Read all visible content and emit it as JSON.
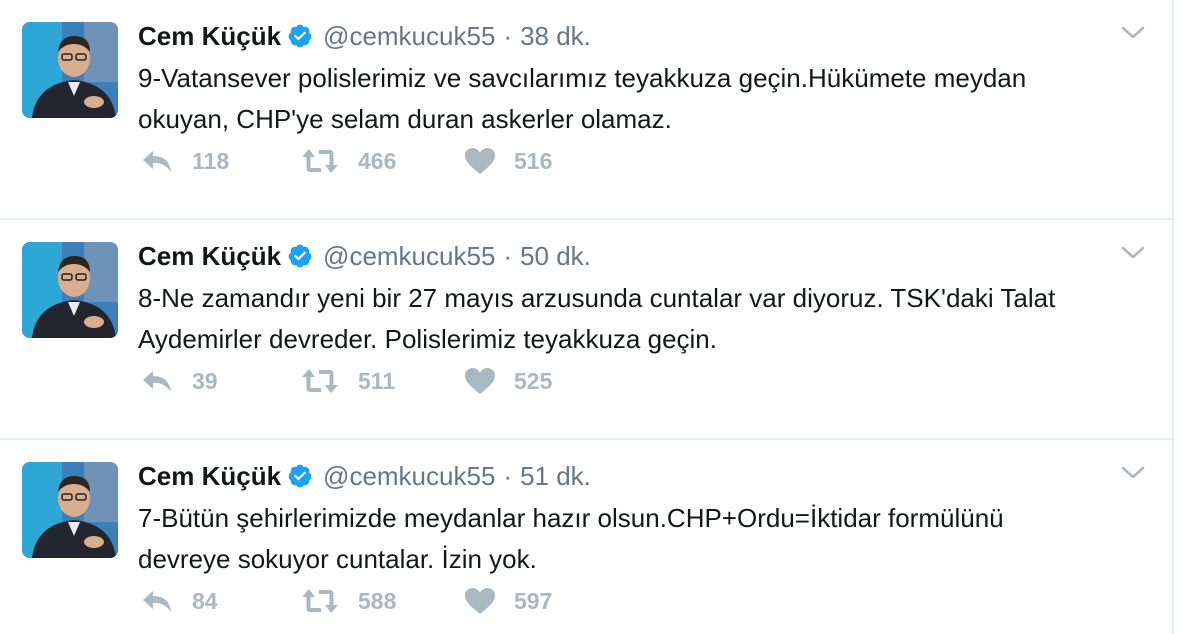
{
  "tweets": [
    {
      "fullname": "Cem Küçük",
      "username": "@cemkucuk55",
      "separator": "·",
      "time": "38 dk.",
      "text_line1": "9-Vatansever polislerimiz ve savcılarımız teyakkuza geçin.Hükümete meydan",
      "text_line2": "okuyan, CHP'ye selam duran askerler olamaz.",
      "replies": "118",
      "retweets": "466",
      "likes": "516"
    },
    {
      "fullname": "Cem Küçük",
      "username": "@cemkucuk55",
      "separator": "·",
      "time": "50 dk.",
      "text_line1": "8-Ne zamandır yeni bir 27 mayıs arzusunda cuntalar var diyoruz. TSK'daki Talat",
      "text_line2": "Aydemirler devreder. Polislerimiz teyakkuza geçin.",
      "replies": "39",
      "retweets": "511",
      "likes": "525"
    },
    {
      "fullname": "Cem Küçük",
      "username": "@cemkucuk55",
      "separator": "·",
      "time": "51 dk.",
      "text_line1": "7-Bütün şehirlerimizde meydanlar hazır olsun.CHP+Ordu=İktidar formülünü",
      "text_line2": "devreye sokuyor cuntalar. İzin yok.",
      "replies": "84",
      "retweets": "588",
      "likes": "597"
    }
  ],
  "colors": {
    "text": "#14171a",
    "secondary": "#657786",
    "action_icon": "#aab8c2",
    "verified": "#1da1f2",
    "divider": "#e6ecf0"
  },
  "icons": {
    "verified": "verified-badge-icon",
    "chevron": "chevron-down-icon",
    "reply": "reply-icon",
    "retweet": "retweet-icon",
    "like": "heart-icon"
  }
}
